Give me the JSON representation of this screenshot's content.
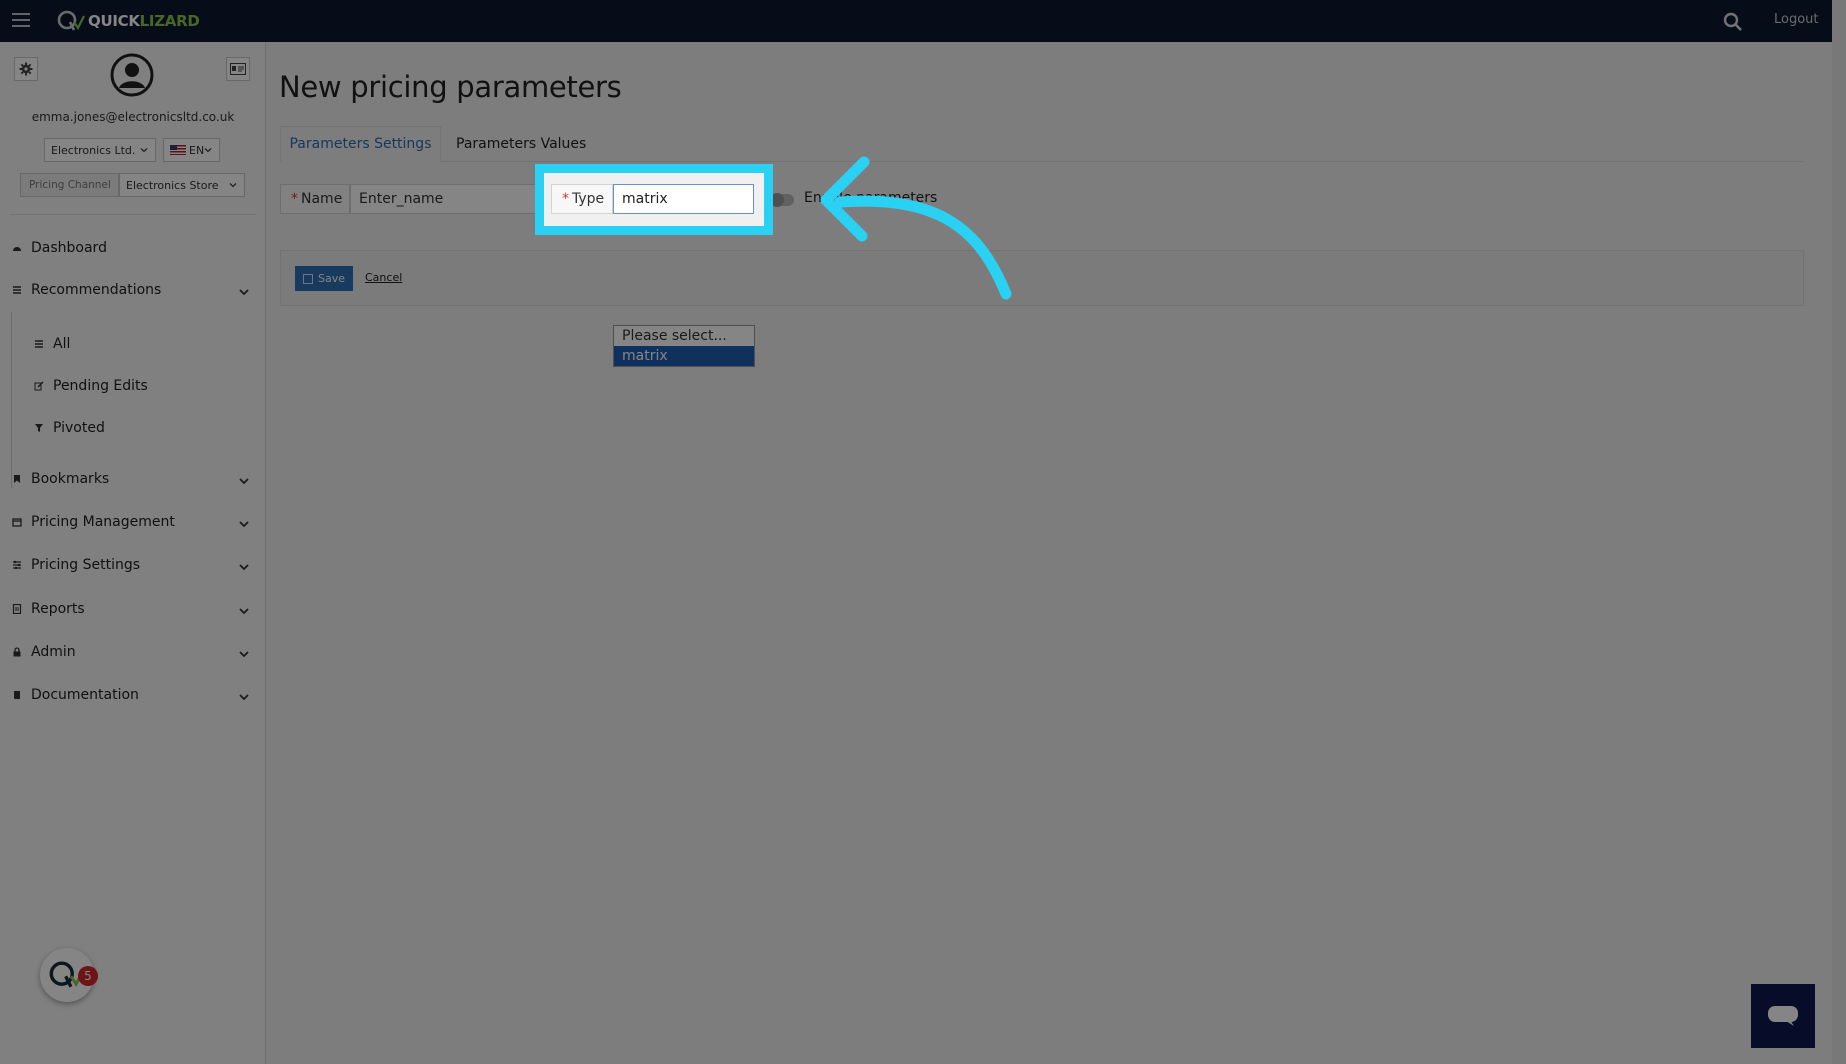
{
  "app": {
    "brand_quick": "QUICK",
    "brand_lizard": "LIZARD",
    "logout": "Logout"
  },
  "sidebar": {
    "email": "emma.jones@electronicsltd.co.uk",
    "company": "Electronics Ltd.",
    "language": "EN",
    "pricing_channel_label": "Pricing Channel",
    "pricing_channel_value": "Electronics Store",
    "items": [
      {
        "label": "Dashboard",
        "icon": "dashboard-icon"
      },
      {
        "label": "Recommendations",
        "icon": "list-icon"
      },
      {
        "label": "Bookmarks",
        "icon": "bookmark-icon"
      },
      {
        "label": "Pricing Management",
        "icon": "calendar-icon"
      },
      {
        "label": "Pricing Settings",
        "icon": "sliders-icon"
      },
      {
        "label": "Reports",
        "icon": "report-icon"
      },
      {
        "label": "Admin",
        "icon": "lock-icon"
      },
      {
        "label": "Documentation",
        "icon": "book-icon"
      }
    ],
    "sub_items": [
      {
        "label": "All",
        "icon": "list-icon"
      },
      {
        "label": "Pending Edits",
        "icon": "edit-icon"
      },
      {
        "label": "Pivoted",
        "icon": "filter-icon"
      }
    ],
    "notification_count": "5"
  },
  "main": {
    "title": "New pricing parameters",
    "tabs": [
      {
        "label": "Parameters Settings",
        "active": true
      },
      {
        "label": "Parameters Values",
        "active": false
      }
    ],
    "name_label": "Name",
    "name_value": "Enter_name",
    "type_label": "Type",
    "type_value": "matrix",
    "toggle_text": "Enable parameters",
    "save_label": "Save",
    "cancel_label": "Cancel",
    "dropdown_options": [
      "Please select...",
      "matrix"
    ],
    "dropdown_selected": "matrix"
  },
  "colors": {
    "topbar": "#0e1a2f",
    "accent_blue": "#2f6fb7",
    "highlight": "#2bd1f2",
    "brand_green": "#8bc34a"
  }
}
